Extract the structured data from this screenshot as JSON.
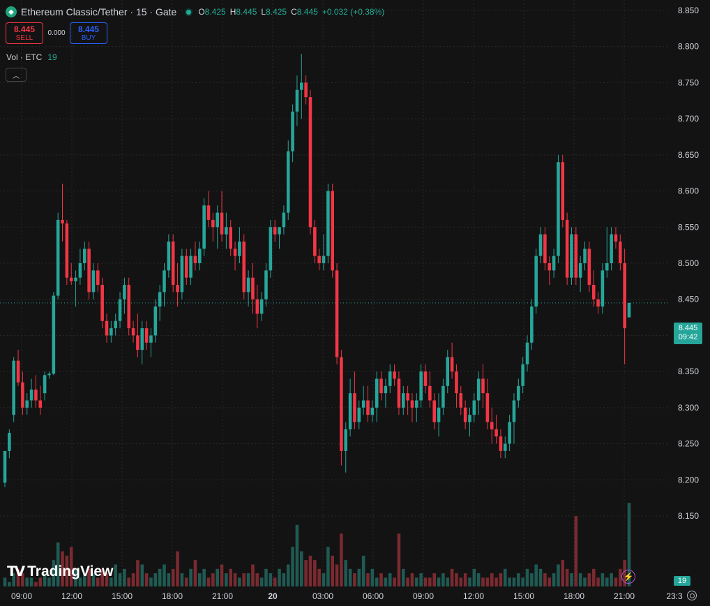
{
  "header": {
    "title": "Ethereum Classic/Tether · 15 · Gate",
    "symbol_icon": "ethereum-classic-icon",
    "ohlc": [
      {
        "key": "O",
        "value": "8.425"
      },
      {
        "key": "H",
        "value": "8.445"
      },
      {
        "key": "L",
        "value": "8.425"
      },
      {
        "key": "C",
        "value": "8.445"
      }
    ],
    "change": "+0.032 (+0.38%)"
  },
  "trade": {
    "sell_price": "8.445",
    "sell_label": "SELL",
    "spread": "0.000",
    "buy_price": "8.445",
    "buy_label": "BUY"
  },
  "volume_indicator": {
    "label": "Vol · ETC",
    "value": "19"
  },
  "collapse_icon": "chevron-up-icon",
  "price_axis": {
    "ticks": [
      "8.850",
      "8.800",
      "8.750",
      "8.700",
      "8.650",
      "8.600",
      "8.550",
      "8.500",
      "8.450",
      "8.400",
      "8.350",
      "8.300",
      "8.250",
      "8.200",
      "8.150"
    ]
  },
  "current_price_tag": {
    "price": "8.445",
    "countdown": "09:42"
  },
  "volume_tag": "19",
  "logo_text": "TradingView",
  "colors": {
    "up": "#26a69a",
    "down": "#f23645",
    "background": "#131313",
    "grid": "#2a2a2a"
  },
  "chart_data": {
    "type": "candlestick",
    "x_tick_labels": [
      "09:00",
      "12:00",
      "15:00",
      "18:00",
      "21:00",
      "20",
      "03:00",
      "06:00",
      "09:00",
      "12:00",
      "15:00",
      "18:00",
      "21:00",
      "23:3"
    ],
    "ylim": [
      8.125,
      8.86
    ],
    "candles": [
      [
        8.196,
        8.24,
        8.19,
        8.24,
        2
      ],
      [
        8.24,
        8.27,
        8.23,
        8.265,
        1
      ],
      [
        8.29,
        8.37,
        8.28,
        8.365,
        3
      ],
      [
        8.365,
        8.38,
        8.33,
        8.335,
        4
      ],
      [
        8.335,
        8.35,
        8.29,
        8.3,
        3
      ],
      [
        8.3,
        8.32,
        8.29,
        8.31,
        2
      ],
      [
        8.31,
        8.34,
        8.3,
        8.325,
        2
      ],
      [
        8.325,
        8.345,
        8.3,
        8.31,
        1
      ],
      [
        8.31,
        8.33,
        8.29,
        8.3,
        2
      ],
      [
        8.32,
        8.35,
        8.31,
        8.345,
        3
      ],
      [
        8.345,
        8.35,
        8.34,
        8.347,
        2
      ],
      [
        8.347,
        8.46,
        8.345,
        8.455,
        6
      ],
      [
        8.455,
        8.57,
        8.45,
        8.56,
        10
      ],
      [
        8.56,
        8.61,
        8.53,
        8.555,
        8
      ],
      [
        8.555,
        8.56,
        8.47,
        8.48,
        7
      ],
      [
        8.48,
        8.5,
        8.47,
        8.475,
        9
      ],
      [
        8.475,
        8.49,
        8.44,
        8.48,
        4
      ],
      [
        8.48,
        8.52,
        8.47,
        8.5,
        2
      ],
      [
        8.5,
        8.53,
        8.49,
        8.52,
        3
      ],
      [
        8.52,
        8.53,
        8.45,
        8.46,
        4
      ],
      [
        8.46,
        8.5,
        8.45,
        8.49,
        3
      ],
      [
        8.49,
        8.5,
        8.46,
        8.47,
        2
      ],
      [
        8.47,
        8.48,
        8.41,
        8.42,
        4
      ],
      [
        8.42,
        8.43,
        8.39,
        8.4,
        3
      ],
      [
        8.4,
        8.42,
        8.39,
        8.41,
        2
      ],
      [
        8.41,
        8.43,
        8.4,
        8.42,
        5
      ],
      [
        8.42,
        8.46,
        8.41,
        8.45,
        3
      ],
      [
        8.45,
        8.48,
        8.43,
        8.47,
        4
      ],
      [
        8.47,
        8.48,
        8.4,
        8.41,
        2
      ],
      [
        8.41,
        8.42,
        8.39,
        8.4,
        3
      ],
      [
        8.4,
        8.43,
        8.37,
        8.38,
        6
      ],
      [
        8.38,
        8.42,
        8.36,
        8.41,
        5
      ],
      [
        8.41,
        8.42,
        8.38,
        8.39,
        3
      ],
      [
        8.39,
        8.41,
        8.37,
        8.4,
        2
      ],
      [
        8.4,
        8.45,
        8.39,
        8.44,
        3
      ],
      [
        8.44,
        8.47,
        8.42,
        8.46,
        4
      ],
      [
        8.46,
        8.5,
        8.44,
        8.49,
        5
      ],
      [
        8.49,
        8.54,
        8.48,
        8.53,
        3
      ],
      [
        8.53,
        8.54,
        8.46,
        8.47,
        4
      ],
      [
        8.47,
        8.5,
        8.44,
        8.46,
        8
      ],
      [
        8.46,
        8.52,
        8.45,
        8.51,
        3
      ],
      [
        8.51,
        8.52,
        8.47,
        8.48,
        2
      ],
      [
        8.48,
        8.52,
        8.47,
        8.51,
        4
      ],
      [
        8.51,
        8.53,
        8.49,
        8.5,
        6
      ],
      [
        8.5,
        8.53,
        8.49,
        8.52,
        3
      ],
      [
        8.52,
        8.59,
        8.51,
        8.58,
        4
      ],
      [
        8.58,
        8.6,
        8.55,
        8.56,
        2
      ],
      [
        8.56,
        8.57,
        8.53,
        8.55,
        3
      ],
      [
        8.55,
        8.58,
        8.52,
        8.57,
        4
      ],
      [
        8.57,
        8.6,
        8.53,
        8.54,
        5
      ],
      [
        8.54,
        8.57,
        8.52,
        8.55,
        3
      ],
      [
        8.55,
        8.56,
        8.51,
        8.52,
        4
      ],
      [
        8.52,
        8.53,
        8.49,
        8.51,
        3
      ],
      [
        8.51,
        8.55,
        8.5,
        8.53,
        2
      ],
      [
        8.53,
        8.54,
        8.45,
        8.46,
        3
      ],
      [
        8.46,
        8.49,
        8.44,
        8.48,
        3
      ],
      [
        8.48,
        8.5,
        8.43,
        8.45,
        5
      ],
      [
        8.45,
        8.47,
        8.41,
        8.43,
        3
      ],
      [
        8.43,
        8.46,
        8.42,
        8.45,
        2
      ],
      [
        8.45,
        8.5,
        8.44,
        8.49,
        4
      ],
      [
        8.49,
        8.56,
        8.48,
        8.55,
        3
      ],
      [
        8.55,
        8.56,
        8.53,
        8.54,
        2
      ],
      [
        8.54,
        8.55,
        8.52,
        8.55,
        4
      ],
      [
        8.55,
        8.58,
        8.54,
        8.57,
        3
      ],
      [
        8.57,
        8.67,
        8.56,
        8.655,
        5
      ],
      [
        8.655,
        8.72,
        8.64,
        8.71,
        9
      ],
      [
        8.71,
        8.76,
        8.69,
        8.74,
        14
      ],
      [
        8.74,
        8.79,
        8.7,
        8.75,
        8
      ],
      [
        8.75,
        8.76,
        8.72,
        8.73,
        6
      ],
      [
        8.73,
        8.74,
        8.54,
        8.55,
        7
      ],
      [
        8.55,
        8.56,
        8.5,
        8.51,
        6
      ],
      [
        8.51,
        8.52,
        8.49,
        8.5,
        4
      ],
      [
        8.5,
        8.54,
        8.49,
        8.51,
        3
      ],
      [
        8.51,
        8.61,
        8.5,
        8.6,
        9
      ],
      [
        8.6,
        8.61,
        8.48,
        8.49,
        7
      ],
      [
        8.49,
        8.5,
        8.36,
        8.37,
        5
      ],
      [
        8.37,
        8.38,
        8.22,
        8.24,
        12
      ],
      [
        8.24,
        8.28,
        8.21,
        8.27,
        6
      ],
      [
        8.27,
        8.34,
        8.26,
        8.32,
        4
      ],
      [
        8.32,
        8.35,
        8.27,
        8.28,
        3
      ],
      [
        8.28,
        8.31,
        8.27,
        8.3,
        4
      ],
      [
        8.3,
        8.33,
        8.29,
        8.31,
        7
      ],
      [
        8.31,
        8.33,
        8.28,
        8.29,
        3
      ],
      [
        8.29,
        8.31,
        8.28,
        8.3,
        4
      ],
      [
        8.3,
        8.35,
        8.28,
        8.34,
        2
      ],
      [
        8.34,
        8.35,
        8.31,
        8.32,
        3
      ],
      [
        8.32,
        8.34,
        8.3,
        8.33,
        2
      ],
      [
        8.33,
        8.36,
        8.32,
        8.35,
        3
      ],
      [
        8.35,
        8.36,
        8.33,
        8.34,
        2
      ],
      [
        8.34,
        8.35,
        8.29,
        8.3,
        12
      ],
      [
        8.3,
        8.33,
        8.29,
        8.32,
        4
      ],
      [
        8.32,
        8.33,
        8.29,
        8.31,
        2
      ],
      [
        8.31,
        8.32,
        8.28,
        8.3,
        3
      ],
      [
        8.3,
        8.32,
        8.28,
        8.31,
        2
      ],
      [
        8.31,
        8.36,
        8.3,
        8.35,
        3
      ],
      [
        8.35,
        8.36,
        8.32,
        8.33,
        2
      ],
      [
        8.33,
        8.35,
        8.3,
        8.31,
        2
      ],
      [
        8.31,
        8.32,
        8.27,
        8.28,
        3
      ],
      [
        8.28,
        8.32,
        8.26,
        8.3,
        2
      ],
      [
        8.3,
        8.34,
        8.29,
        8.33,
        3
      ],
      [
        8.33,
        8.38,
        8.32,
        8.37,
        2
      ],
      [
        8.37,
        8.39,
        8.34,
        8.35,
        4
      ],
      [
        8.35,
        8.36,
        8.3,
        8.32,
        3
      ],
      [
        8.32,
        8.33,
        8.29,
        8.3,
        2
      ],
      [
        8.3,
        8.31,
        8.27,
        8.28,
        3
      ],
      [
        8.28,
        8.3,
        8.26,
        8.29,
        2
      ],
      [
        8.29,
        8.32,
        8.28,
        8.31,
        4
      ],
      [
        8.31,
        8.35,
        8.29,
        8.34,
        3
      ],
      [
        8.34,
        8.36,
        8.3,
        8.32,
        2
      ],
      [
        8.32,
        8.34,
        8.27,
        8.28,
        2
      ],
      [
        8.28,
        8.3,
        8.25,
        8.27,
        3
      ],
      [
        8.27,
        8.29,
        8.25,
        8.26,
        2
      ],
      [
        8.26,
        8.27,
        8.23,
        8.24,
        3
      ],
      [
        8.24,
        8.26,
        8.23,
        8.25,
        4
      ],
      [
        8.25,
        8.29,
        8.24,
        8.28,
        2
      ],
      [
        8.28,
        8.32,
        8.25,
        8.31,
        2
      ],
      [
        8.31,
        8.34,
        8.3,
        8.33,
        3
      ],
      [
        8.33,
        8.37,
        8.32,
        8.36,
        2
      ],
      [
        8.36,
        8.4,
        8.35,
        8.39,
        4
      ],
      [
        8.39,
        8.45,
        8.38,
        8.44,
        3
      ],
      [
        8.44,
        8.52,
        8.43,
        8.51,
        5
      ],
      [
        8.51,
        8.55,
        8.5,
        8.54,
        4
      ],
      [
        8.54,
        8.55,
        8.49,
        8.5,
        3
      ],
      [
        8.5,
        8.51,
        8.47,
        8.49,
        2
      ],
      [
        8.49,
        8.52,
        8.48,
        8.51,
        3
      ],
      [
        8.51,
        8.65,
        8.5,
        8.64,
        5
      ],
      [
        8.64,
        8.65,
        8.55,
        8.56,
        6
      ],
      [
        8.56,
        8.57,
        8.47,
        8.48,
        4
      ],
      [
        8.48,
        8.55,
        8.47,
        8.54,
        3
      ],
      [
        8.54,
        8.55,
        8.47,
        8.48,
        16
      ],
      [
        8.48,
        8.51,
        8.46,
        8.5,
        3
      ],
      [
        8.5,
        8.53,
        8.49,
        8.52,
        2
      ],
      [
        8.52,
        8.53,
        8.46,
        8.47,
        3
      ],
      [
        8.47,
        8.49,
        8.44,
        8.45,
        4
      ],
      [
        8.45,
        8.46,
        8.43,
        8.44,
        2
      ],
      [
        8.44,
        8.5,
        8.43,
        8.49,
        3
      ],
      [
        8.49,
        8.55,
        8.48,
        8.5,
        2
      ],
      [
        8.5,
        8.55,
        8.49,
        8.54,
        3
      ],
      [
        8.54,
        8.55,
        8.52,
        8.53,
        2
      ],
      [
        8.53,
        8.54,
        8.49,
        8.5,
        4
      ],
      [
        8.5,
        8.52,
        8.36,
        8.41,
        6
      ],
      [
        8.425,
        8.445,
        8.425,
        8.445,
        19
      ]
    ]
  }
}
